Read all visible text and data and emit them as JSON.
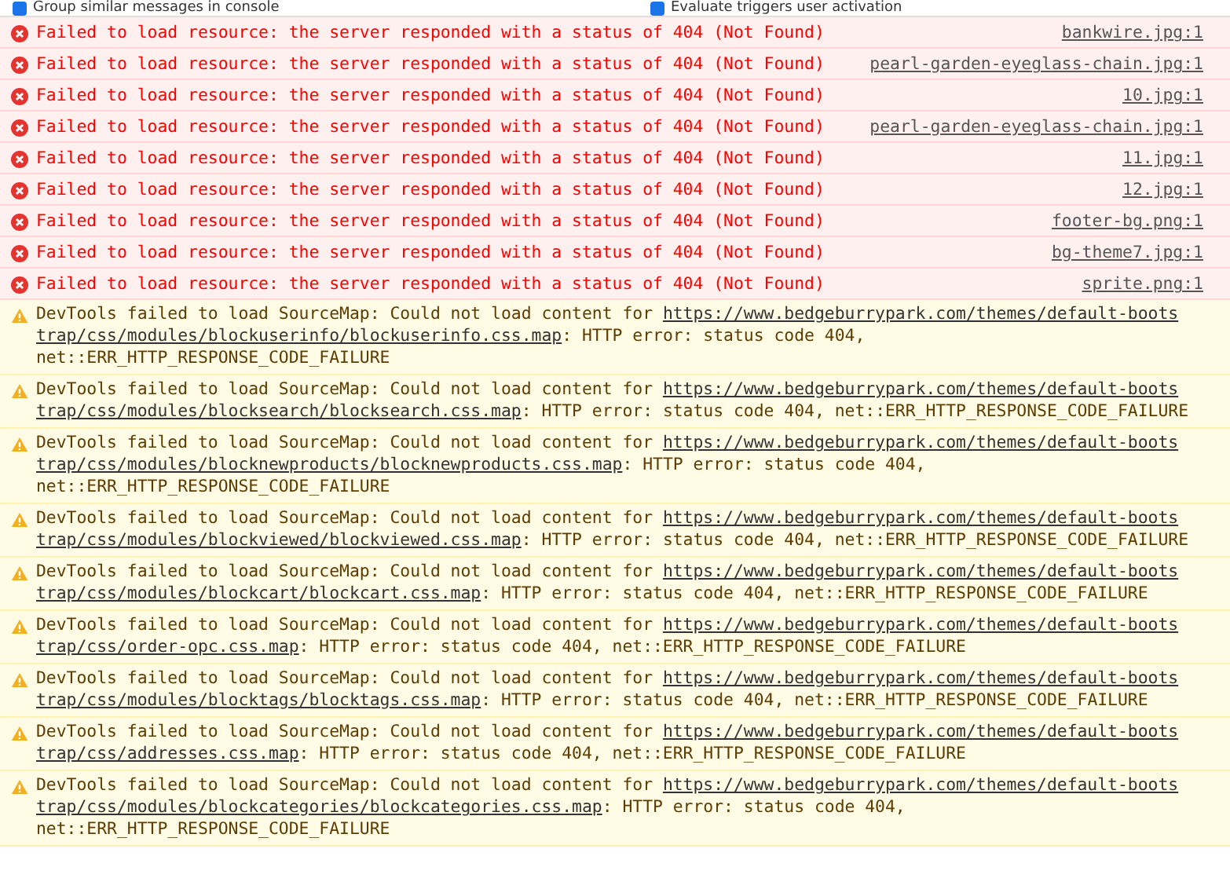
{
  "settings": [
    {
      "label": "Group similar messages in console",
      "checked": true
    },
    {
      "label": "Evaluate triggers user activation",
      "checked": true
    }
  ],
  "messages": [
    {
      "kind": "error",
      "text": "Failed to load resource: the server responded with a status of 404 (Not Found)",
      "source": "bankwire.jpg:1"
    },
    {
      "kind": "error",
      "text": "Failed to load resource: the server responded with a status of 404 (Not Found)",
      "source": "pearl-garden-eyeglass-chain.jpg:1"
    },
    {
      "kind": "error",
      "text": "Failed to load resource: the server responded with a status of 404 (Not Found)",
      "source": "10.jpg:1"
    },
    {
      "kind": "error",
      "text": "Failed to load resource: the server responded with a status of 404 (Not Found)",
      "source": "pearl-garden-eyeglass-chain.jpg:1"
    },
    {
      "kind": "error",
      "text": "Failed to load resource: the server responded with a status of 404 (Not Found)",
      "source": "11.jpg:1"
    },
    {
      "kind": "error",
      "text": "Failed to load resource: the server responded with a status of 404 (Not Found)",
      "source": "12.jpg:1"
    },
    {
      "kind": "error",
      "text": "Failed to load resource: the server responded with a status of 404 (Not Found)",
      "source": "footer-bg.png:1"
    },
    {
      "kind": "error",
      "text": "Failed to load resource: the server responded with a status of 404 (Not Found)",
      "source": "bg-theme7.jpg:1"
    },
    {
      "kind": "error",
      "text": "Failed to load resource: the server responded with a status of 404 (Not Found)",
      "source": "sprite.png:1"
    },
    {
      "kind": "warning",
      "text": "DevTools failed to load SourceMap: Could not load content for",
      "link": "https://www.bedgeburrypark.com/themes/default-bootstrap/css/modules/blockuserinfo/blockuserinfo.css.map",
      "after": ": HTTP error: status code 404, net::ERR_HTTP_RESPONSE_CODE_FAILURE"
    },
    {
      "kind": "warning",
      "text": "DevTools failed to load SourceMap: Could not load content for",
      "link": "https://www.bedgeburrypark.com/themes/default-bootstrap/css/modules/blocksearch/blocksearch.css.map",
      "after": ": HTTP error: status code 404, net::ERR_HTTP_RESPONSE_CODE_FAILURE"
    },
    {
      "kind": "warning",
      "text": "DevTools failed to load SourceMap: Could not load content for",
      "link": "https://www.bedgeburrypark.com/themes/default-bootstrap/css/modules/blocknewproducts/blocknewproducts.css.map",
      "after": ": HTTP error: status code 404, net::ERR_HTTP_RESPONSE_CODE_FAILURE"
    },
    {
      "kind": "warning",
      "text": "DevTools failed to load SourceMap: Could not load content for",
      "link": "https://www.bedgeburrypark.com/themes/default-bootstrap/css/modules/blockviewed/blockviewed.css.map",
      "after": ": HTTP error: status code 404, net::ERR_HTTP_RESPONSE_CODE_FAILURE"
    },
    {
      "kind": "warning",
      "text": "DevTools failed to load SourceMap: Could not load content for",
      "link": "https://www.bedgeburrypark.com/themes/default-bootstrap/css/modules/blockcart/blockcart.css.map",
      "after": ": HTTP error: status code 404, net::ERR_HTTP_RESPONSE_CODE_FAILURE"
    },
    {
      "kind": "warning",
      "text": "DevTools failed to load SourceMap: Could not load content for",
      "link": "https://www.bedgeburrypark.com/themes/default-bootstrap/css/order-opc.css.map",
      "after": ": HTTP error: status code 404, net::ERR_HTTP_RESPONSE_CODE_FAILURE"
    },
    {
      "kind": "warning",
      "text": "DevTools failed to load SourceMap: Could not load content for",
      "link": "https://www.bedgeburrypark.com/themes/default-bootstrap/css/modules/blocktags/blocktags.css.map",
      "after": ": HTTP error: status code 404, net::ERR_HTTP_RESPONSE_CODE_FAILURE"
    },
    {
      "kind": "warning",
      "text": "DevTools failed to load SourceMap: Could not load content for",
      "link": "https://www.bedgeburrypark.com/themes/default-bootstrap/css/addresses.css.map",
      "after": ": HTTP error: status code 404, net::ERR_HTTP_RESPONSE_CODE_FAILURE"
    },
    {
      "kind": "warning",
      "text": "DevTools failed to load SourceMap: Could not load content for",
      "link": "https://www.bedgeburrypark.com/themes/default-bootstrap/css/modules/blockcategories/blockcategories.css.map",
      "after": ": HTTP error: status code 404, net::ERR_HTTP_RESPONSE_CODE_FAILURE"
    }
  ]
}
